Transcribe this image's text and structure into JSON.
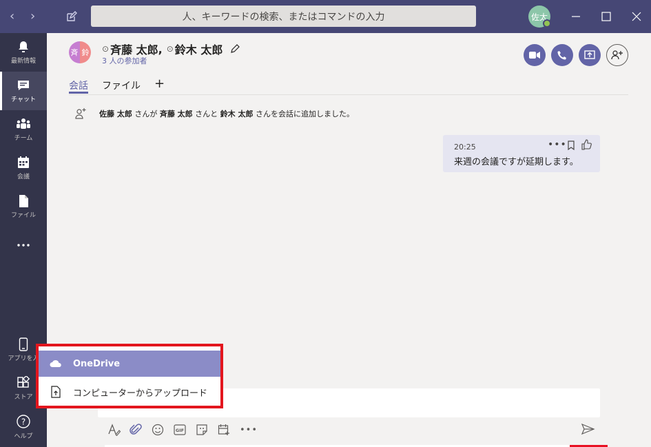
{
  "titlebar": {
    "search_placeholder": "人、キーワードの検索、またはコマンドの入力",
    "back_icon": "‹",
    "forward_icon": "›",
    "user_initials": "佐太"
  },
  "rail": {
    "items": [
      {
        "label": "最新情報",
        "icon": "bell-icon"
      },
      {
        "label": "チャット",
        "icon": "chat-icon"
      },
      {
        "label": "チーム",
        "icon": "teams-icon"
      },
      {
        "label": "会議",
        "icon": "calendar-icon"
      },
      {
        "label": "ファイル",
        "icon": "file-icon"
      },
      {
        "label": "",
        "icon": "more-icon"
      },
      {
        "label": "アプリを入",
        "icon": "phone-icon"
      },
      {
        "label": "ストア",
        "icon": "store-icon"
      },
      {
        "label": "ヘルプ",
        "icon": "help-icon"
      }
    ]
  },
  "chat": {
    "avatar_left": "斉",
    "avatar_right": "鈴",
    "title_name1": "斉藤 太郎",
    "title_sep": ",",
    "title_name2": "鈴木 太郎",
    "participants": "3 人の参加者",
    "tabs": [
      "会話",
      "ファイル"
    ],
    "tab_add": "+"
  },
  "system_message": {
    "actor": "佐藤 太郎",
    "text1": " さんが ",
    "person1": "斉藤 太郎",
    "text2": " さんと ",
    "person2": "鈴木 太郎",
    "text3": " さんを会話に追加しました。"
  },
  "message": {
    "time": "20:25",
    "text": "来週の会議ですが延期します。",
    "more": "•••"
  },
  "compose": {
    "more": "•••",
    "tools": [
      "format-icon",
      "attach-icon",
      "emoji-icon",
      "gif-icon",
      "sticker-icon",
      "schedule-icon"
    ]
  },
  "attach_menu": {
    "onedrive": "OneDrive",
    "upload": "コンピューターからアップロード"
  },
  "colors": {
    "titlebar": "#464775",
    "rail": "#33344a",
    "accent": "#6264a7",
    "highlight_box": "#e3161e"
  }
}
